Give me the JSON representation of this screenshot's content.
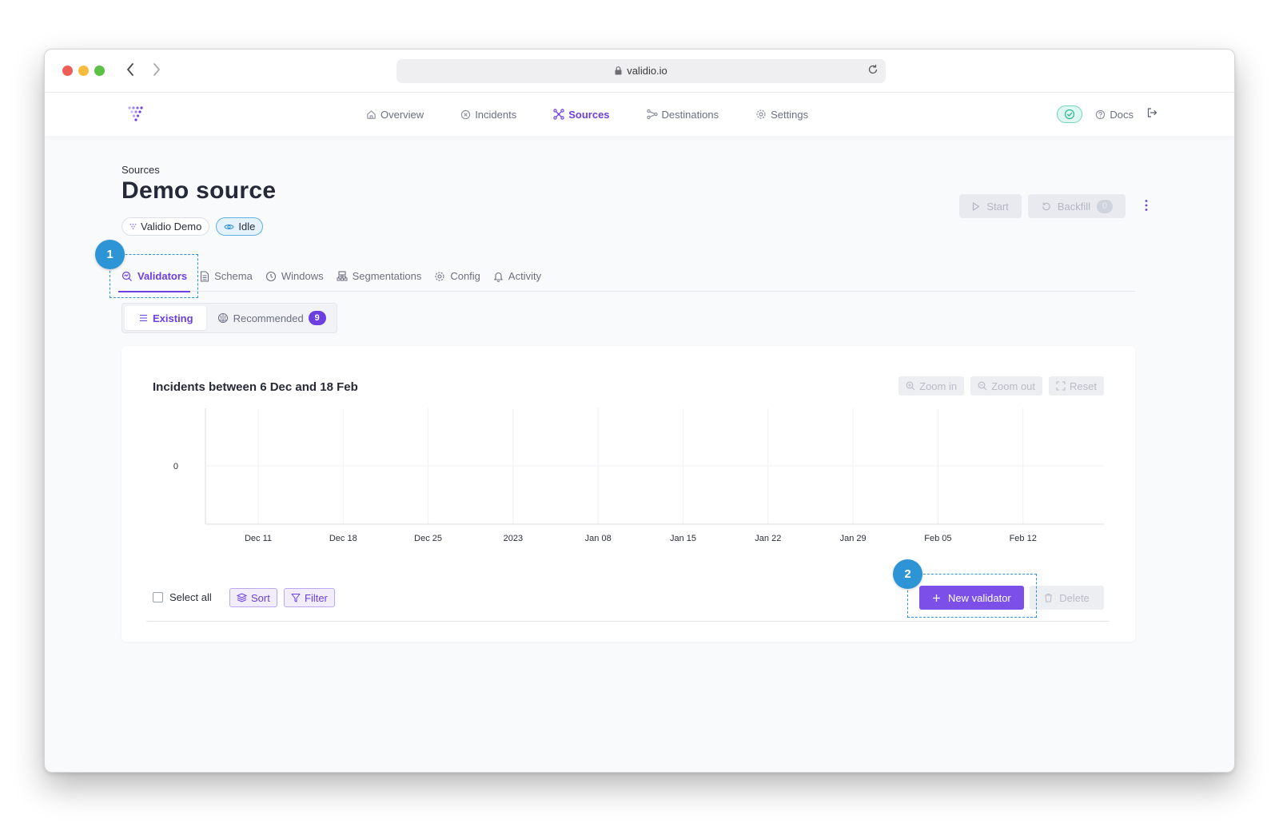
{
  "browser": {
    "url": "validio.io"
  },
  "nav": {
    "items": [
      {
        "label": "Overview",
        "icon": "home-icon"
      },
      {
        "label": "Incidents",
        "icon": "x-circle-icon"
      },
      {
        "label": "Sources",
        "icon": "network-icon",
        "active": true
      },
      {
        "label": "Destinations",
        "icon": "share-icon"
      },
      {
        "label": "Settings",
        "icon": "gear-icon"
      }
    ],
    "docs_label": "Docs"
  },
  "page": {
    "breadcrumb": "Sources",
    "title": "Demo source",
    "tags": {
      "workspace": "Validio Demo",
      "status": "Idle"
    },
    "actions": {
      "start_label": "Start",
      "backfill_label": "Backfill",
      "backfill_count": "0"
    }
  },
  "tabs": [
    {
      "label": "Validators",
      "icon": "validator-icon",
      "active": true
    },
    {
      "label": "Schema",
      "icon": "document-icon"
    },
    {
      "label": "Windows",
      "icon": "clock-icon"
    },
    {
      "label": "Segmentations",
      "icon": "hierarchy-icon"
    },
    {
      "label": "Config",
      "icon": "gear-icon"
    },
    {
      "label": "Activity",
      "icon": "bell-icon"
    }
  ],
  "subtabs": {
    "existing_label": "Existing",
    "recommended_label": "Recommended",
    "recommended_count": "9"
  },
  "chart_data": {
    "type": "bar",
    "title": "Incidents between 6 Dec and 18 Feb",
    "x": [
      "Dec 11",
      "Dec 18",
      "Dec 25",
      "2023",
      "Jan 08",
      "Jan 15",
      "Jan 22",
      "Jan 29",
      "Feb 05",
      "Feb 12"
    ],
    "y_ticks": [
      "0"
    ],
    "values": [],
    "grid": true
  },
  "chart_controls": {
    "zoom_in": "Zoom in",
    "zoom_out": "Zoom out",
    "reset": "Reset"
  },
  "toolbar": {
    "select_all": "Select all",
    "sort": "Sort",
    "filter": "Filter",
    "new_validator": "New validator",
    "delete": "Delete"
  },
  "callouts": [
    "1",
    "2"
  ],
  "colors": {
    "accent": "#6b3fe0",
    "callout": "#2d94d6"
  }
}
